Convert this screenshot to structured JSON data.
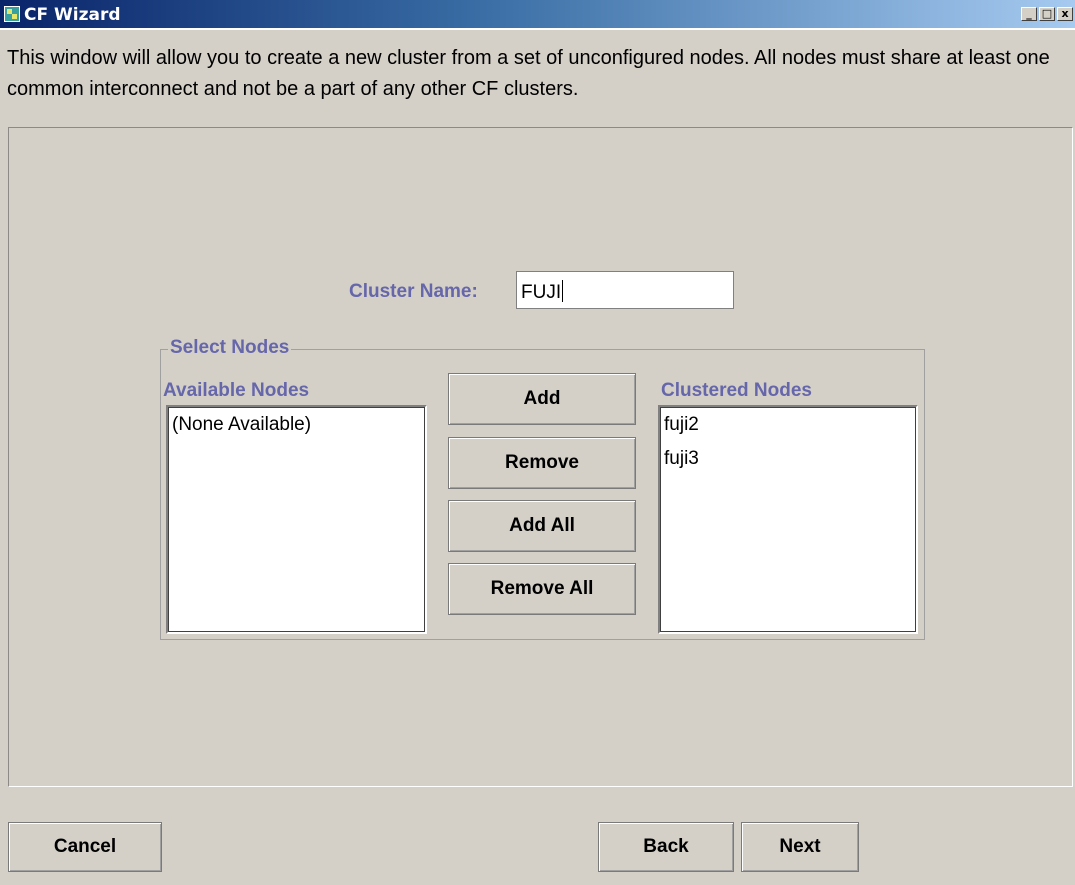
{
  "window": {
    "title": "CF Wizard",
    "controls": {
      "minimize": "_",
      "maximize": "□",
      "close": "x"
    }
  },
  "description": "This window will allow you to create a new cluster from a set of unconfigured nodes.  All nodes must share at least one common interconnect and not be a part of any other CF clusters.",
  "cluster": {
    "label": "Cluster Name:",
    "value": "FUJI"
  },
  "select_nodes": {
    "title": "Select Nodes",
    "available": {
      "label": "Available Nodes",
      "items": [
        "(None Available)"
      ]
    },
    "clustered": {
      "label": "Clustered Nodes",
      "items": [
        "fuji2",
        "fuji3"
      ]
    },
    "buttons": {
      "add": "Add",
      "remove": "Remove",
      "add_all": "Add All",
      "remove_all": "Remove All"
    }
  },
  "footer": {
    "cancel": "Cancel",
    "back": "Back",
    "next": "Next"
  },
  "colors": {
    "background": "#d4d0c8",
    "label_accent": "#6666aa",
    "title_bar": "#0a246a"
  }
}
